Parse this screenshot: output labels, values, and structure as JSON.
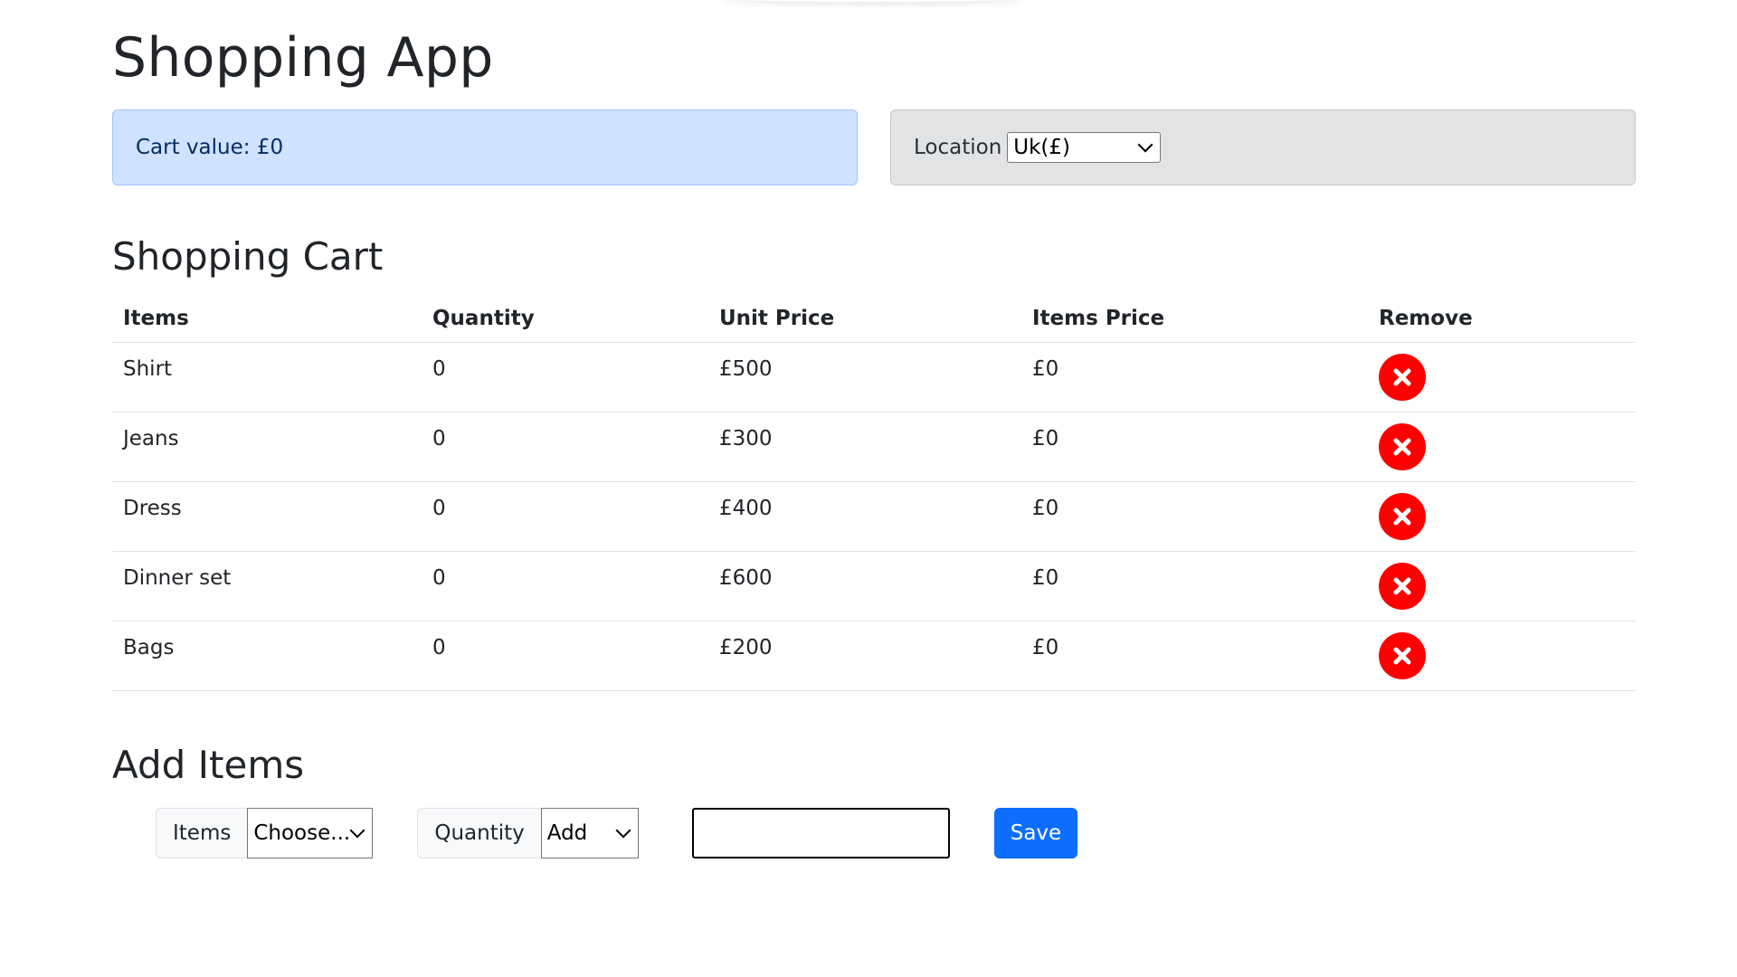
{
  "app": {
    "title": "Shopping App"
  },
  "cart_alert": {
    "text": "Cart value: £0"
  },
  "location": {
    "label": "Location",
    "selected": "Uk(£)"
  },
  "cart": {
    "title": "Shopping Cart",
    "headers": [
      "Items",
      "Quantity",
      "Unit Price",
      "Items Price",
      "Remove"
    ],
    "rows": [
      {
        "item": "Shirt",
        "quantity": "0",
        "unit_price": "£500",
        "items_price": "£0"
      },
      {
        "item": "Jeans",
        "quantity": "0",
        "unit_price": "£300",
        "items_price": "£0"
      },
      {
        "item": "Dress",
        "quantity": "0",
        "unit_price": "£400",
        "items_price": "£0"
      },
      {
        "item": "Dinner set",
        "quantity": "0",
        "unit_price": "£600",
        "items_price": "£0"
      },
      {
        "item": "Bags",
        "quantity": "0",
        "unit_price": "£200",
        "items_price": "£0"
      }
    ],
    "remove_icon": "close-circle-icon",
    "remove_color": "#ff0000"
  },
  "add_items": {
    "title": "Add Items",
    "items_label": "Items",
    "items_selected": "Choose...",
    "quantity_label": "Quantity",
    "quantity_selected": "Add",
    "quantity_input_value": "",
    "save_label": "Save"
  },
  "colors": {
    "primary": "#0d6efd",
    "info_bg": "#cfe2ff",
    "secondary_bg": "#e2e3e5"
  }
}
